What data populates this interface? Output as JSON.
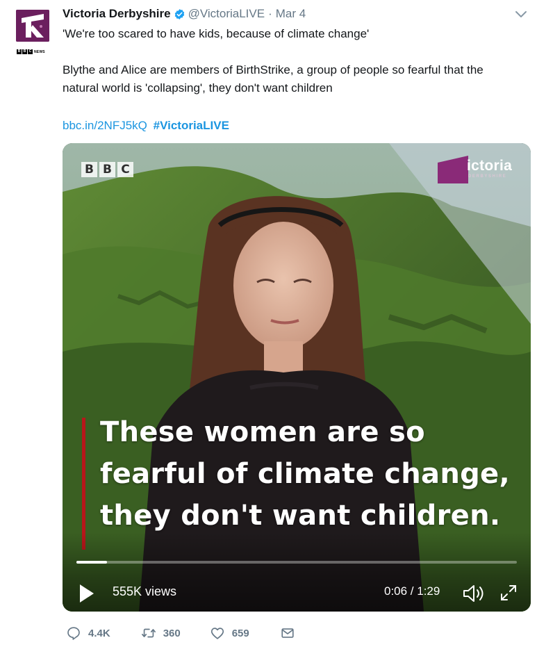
{
  "tweet": {
    "display_name": "Victoria Derbyshire",
    "handle": "@VictoriaLIVE",
    "separator": "·",
    "date": "Mar 4",
    "text_line1": "'We're too scared to have kids, because of climate change'",
    "text_line2": "Blythe and Alice are members of BirthStrike, a group of people so fearful that the",
    "text_line3": "natural world is 'collapsing', they don't want children",
    "link": "bbc.in/2NFJ5kQ",
    "hashtag": "#VictoriaLIVE"
  },
  "avatar": {
    "bbc_letters": [
      "B",
      "B",
      "C"
    ],
    "news_label": "NEWS"
  },
  "video": {
    "bbc_letters": [
      "B",
      "B",
      "C"
    ],
    "brand_title": "ictoria",
    "brand_subtitle": "DERBYSHIRE",
    "caption": "These women are so fearful of climate change, they don't want children.",
    "views": "555K views",
    "time": "0:06 / 1:29",
    "progress_fraction": 0.069
  },
  "actions": {
    "replies": "4.4K",
    "retweets": "360",
    "likes": "659"
  },
  "colors": {
    "link": "#1b95e0",
    "muted": "#657786",
    "brand_purple": "#8a2a78",
    "caption_bar": "#b8161a"
  },
  "icons": [
    "verified-badge-icon",
    "chevron-down-icon",
    "play-icon",
    "volume-icon",
    "expand-icon",
    "reply-icon",
    "retweet-icon",
    "like-icon",
    "share-icon"
  ]
}
